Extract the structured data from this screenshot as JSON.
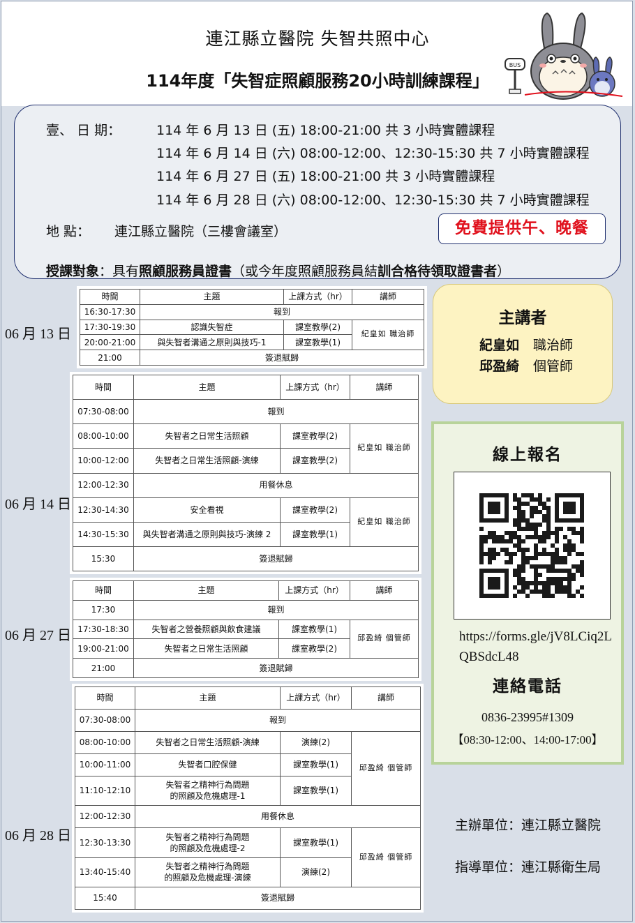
{
  "header": {
    "org_title": "連江縣立醫院  失智共照中心",
    "course_title": "114年度「失智症照顧服務20小時訓練課程」",
    "mascot_sign": "BUS"
  },
  "info": {
    "date_label": "壹、  日      期：",
    "dates": [
      "114 年 6 月 13 日 (五) 18:00-21:00  共 3 小時實體課程",
      "114 年 6 月 14 日 (六) 08:00-12:00、12:30-15:30  共 7 小時實體課程",
      "114 年 6 月 27 日 (五) 18:00-21:00  共 3 小時實體課程",
      "114 年 6 月 28 日 (六) 08:00-12:00、12:30-15:30  共 7 小時實體課程"
    ],
    "location_label": "地      點：",
    "location": "連江縣立醫院（三樓會議室）",
    "meal": "免費提供午、晚餐",
    "target_label": "授課對象",
    "target_a": "：具有",
    "target_b": "照顧服務員證書",
    "target_c": "（或今年度照顧服務員結",
    "target_d": "訓合格待領取證書者",
    "target_e": "）"
  },
  "table_headers": {
    "time": "時間",
    "topic": "主題",
    "mode": "上課方式（hr）",
    "instructor": "講師"
  },
  "days": [
    {
      "label": "06 月 13 日",
      "rows": [
        {
          "time": "16:30-17:30",
          "topic": "報到"
        },
        {
          "time": "17:30-19:30",
          "topic": "認識失智症",
          "mode": "課室教學(2)"
        },
        {
          "time": "20:00-21:00",
          "topic": "與失智者溝通之原則與技巧-1",
          "mode": "課室教學(1)"
        },
        {
          "time": "21:00",
          "topic": "簽退賦歸"
        }
      ],
      "instructors": [
        "紀皇如 職治師"
      ]
    },
    {
      "label": "06 月 14 日",
      "rows": [
        {
          "time": "07:30-08:00",
          "topic": "報到"
        },
        {
          "time": "08:00-10:00",
          "topic": "失智者之日常生活照顧",
          "mode": "課室教學(2)"
        },
        {
          "time": "10:00-12:00",
          "topic": "失智者之日常生活照顧-演練",
          "mode": "課室教學(2)"
        },
        {
          "time": "12:00-12:30",
          "topic": "用餐休息"
        },
        {
          "time": "12:30-14:30",
          "topic": "安全看視",
          "mode": "課室教學(2)"
        },
        {
          "time": "14:30-15:30",
          "topic": "與失智者溝通之原則與技巧-演練 2",
          "mode": "課室教學(1)"
        },
        {
          "time": "15:30",
          "topic": "簽退賦歸"
        }
      ],
      "instructors": [
        "紀皇如 職治師",
        "紀皇如 職治師"
      ]
    },
    {
      "label": "06 月 27 日",
      "rows": [
        {
          "time": "17:30",
          "topic": "報到"
        },
        {
          "time": "17:30-18:30",
          "topic": "失智者之營養照顧與飲食建議",
          "mode": "課室教學(1)"
        },
        {
          "time": "19:00-21:00",
          "topic": "失智者之日常生活照顧",
          "mode": "課室教學(2)"
        },
        {
          "time": "21:00",
          "topic": "簽退賦歸"
        }
      ],
      "instructors": [
        "邱盈綺 個管師"
      ]
    },
    {
      "label": "06 月 28 日",
      "rows": [
        {
          "time": "07:30-08:00",
          "topic": "報到"
        },
        {
          "time": "08:00-10:00",
          "topic": "失智者之日常生活照顧-演練",
          "mode": "演練(2)"
        },
        {
          "time": "10:00-11:00",
          "topic": "失智者口腔保健",
          "mode": "課室教學(1)"
        },
        {
          "time": "11:10-12:10",
          "topic": "失智者之精神行為問題",
          "topic2": "的照顧及危機處理-1",
          "mode": "課室教學(1)"
        },
        {
          "time": "12:00-12:30",
          "topic": "用餐休息"
        },
        {
          "time": "12:30-13:30",
          "topic": "失智者之精神行為問題",
          "topic2": "的照顧及危機處理-2",
          "mode": "課室教學(1)"
        },
        {
          "time": "13:40-15:40",
          "topic": "失智者之精神行為問題",
          "topic2": "的照顧及危機處理-演練",
          "mode": "演練(2)"
        },
        {
          "time": "15:40",
          "topic": "簽退賦歸"
        }
      ],
      "instructors": [
        "邱盈綺 個管師",
        "邱盈綺 個管師"
      ]
    }
  ],
  "speakers": {
    "title": "主講者",
    "list": [
      {
        "name": "紀皇如",
        "role": "職治師"
      },
      {
        "name": "邱盈綺",
        "role": "個管師"
      }
    ]
  },
  "registration": {
    "title": "線上報名",
    "url": "https://forms.gle/jV8LCiq2LQBSdcL48",
    "phone_title": "連絡電話",
    "phone": "0836-23995#1309",
    "hours": "【08:30-12:00、14:00-17:00】"
  },
  "organizers": {
    "host": "主辦單位：連江縣立醫院",
    "guide": "指導單位：連江縣衛生局"
  }
}
